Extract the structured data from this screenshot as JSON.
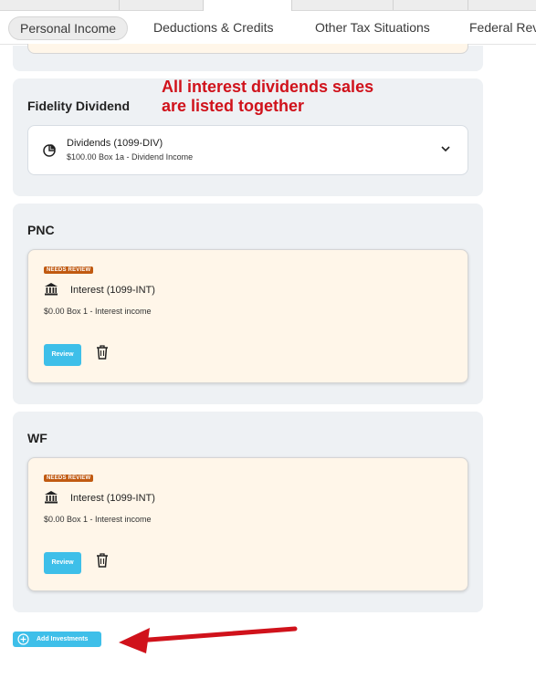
{
  "nav": {
    "tabs": [
      {
        "label": "Personal Income",
        "active": true
      },
      {
        "label": "Deductions & Credits",
        "active": false
      },
      {
        "label": "Other Tax Situations",
        "active": false
      },
      {
        "label": "Federal Rev",
        "active": false
      }
    ]
  },
  "annotation": {
    "line1": "All interest dividends sales",
    "line2": "are listed together",
    "color": "#d0121b"
  },
  "groups": [
    {
      "title": "Fidelity Dividend",
      "item": {
        "title": "Dividends (1099-DIV)",
        "subtitle": "$100.00 Box 1a - Dividend Income",
        "icon": "pie-chart-icon"
      }
    },
    {
      "title": "PNC",
      "item": {
        "badge": "NEEDS REVIEW",
        "title": "Interest (1099-INT)",
        "subtitle": "$0.00 Box 1 - Interest income",
        "button": "Review",
        "icon": "bank-icon"
      }
    },
    {
      "title": "WF",
      "item": {
        "badge": "NEEDS REVIEW",
        "title": "Interest (1099-INT)",
        "subtitle": "$0.00 Box 1 - Interest income",
        "button": "Review",
        "icon": "bank-icon"
      }
    }
  ],
  "add_button": {
    "label": "Add Investments"
  },
  "colors": {
    "accent": "#3ebfe9",
    "badge": "#c15a11",
    "review_card_bg": "#fff6e9",
    "group_bg": "#eef1f4"
  }
}
